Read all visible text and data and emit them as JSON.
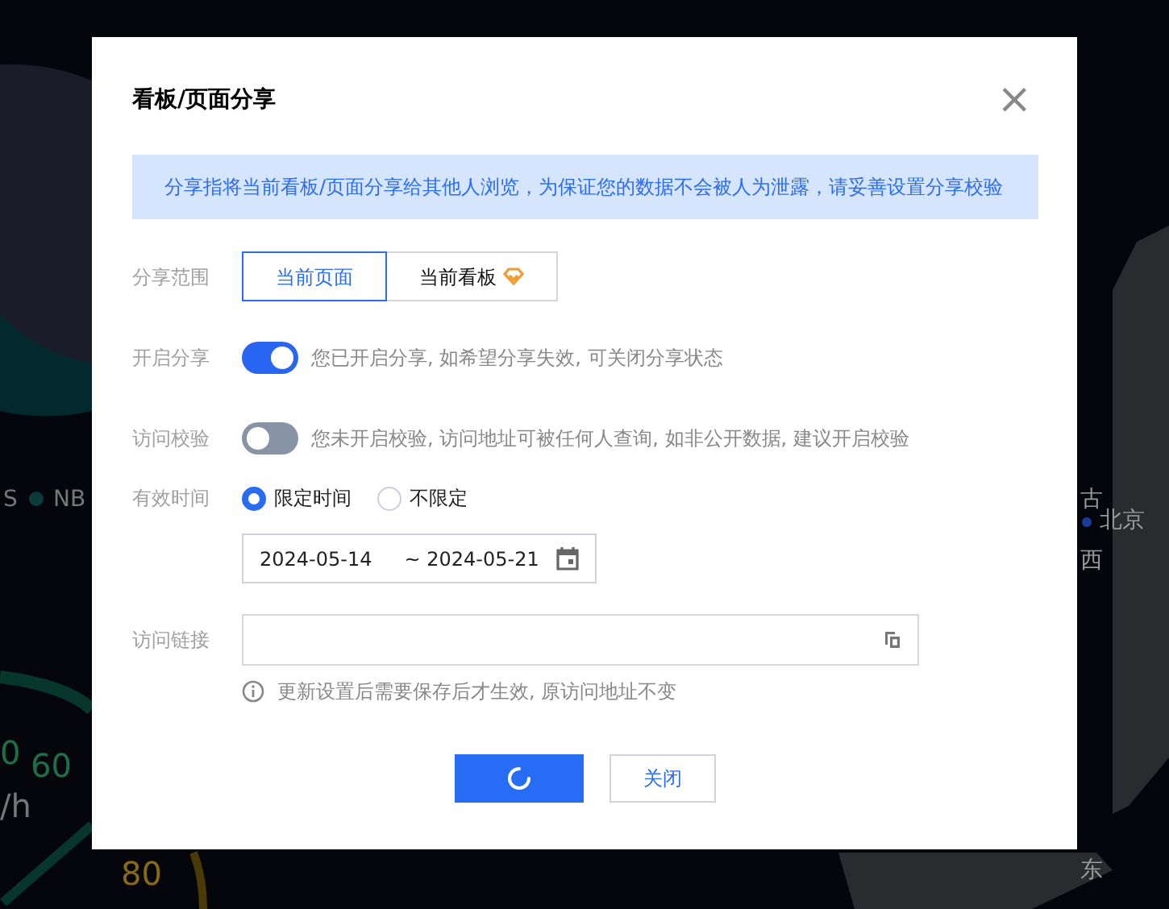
{
  "backdrop": {
    "legend": [
      "S",
      "NB"
    ],
    "gauge_labels": [
      "0",
      "60",
      "/h",
      "80"
    ],
    "map_labels": [
      "古",
      "北京",
      "西",
      "东"
    ]
  },
  "dialog": {
    "title": "看板/页面分享",
    "close": "×",
    "notice": "分享指将当前看板/页面分享给其他人浏览，为保证您的数据不会被人为泄露，请妥善设置分享校验",
    "scope": {
      "label": "分享范围",
      "options": [
        {
          "label": "当前页面",
          "selected": true,
          "premium": false
        },
        {
          "label": "当前看板",
          "selected": false,
          "premium": true
        }
      ]
    },
    "sharing": {
      "label": "开启分享",
      "on": true,
      "note": "您已开启分享, 如希望分享失效, 可关闭分享状态"
    },
    "verification": {
      "label": "访问校验",
      "on": false,
      "note": "您未开启校验, 访问地址可被任何人查询, 如非公开数据, 建议开启校验"
    },
    "validity": {
      "label": "有效时间",
      "options": [
        {
          "label": "限定时间",
          "selected": true
        },
        {
          "label": "不限定",
          "selected": false
        }
      ],
      "start": "2024-05-14",
      "end": "~ 2024-05-21"
    },
    "link": {
      "label": "访问链接",
      "hint": "更新设置后需要保存后才生效, 原访问地址不变"
    },
    "buttons": [
      {
        "kind": "primary",
        "loading": true
      },
      {
        "kind": "secondary",
        "label": "关闭"
      }
    ]
  }
}
